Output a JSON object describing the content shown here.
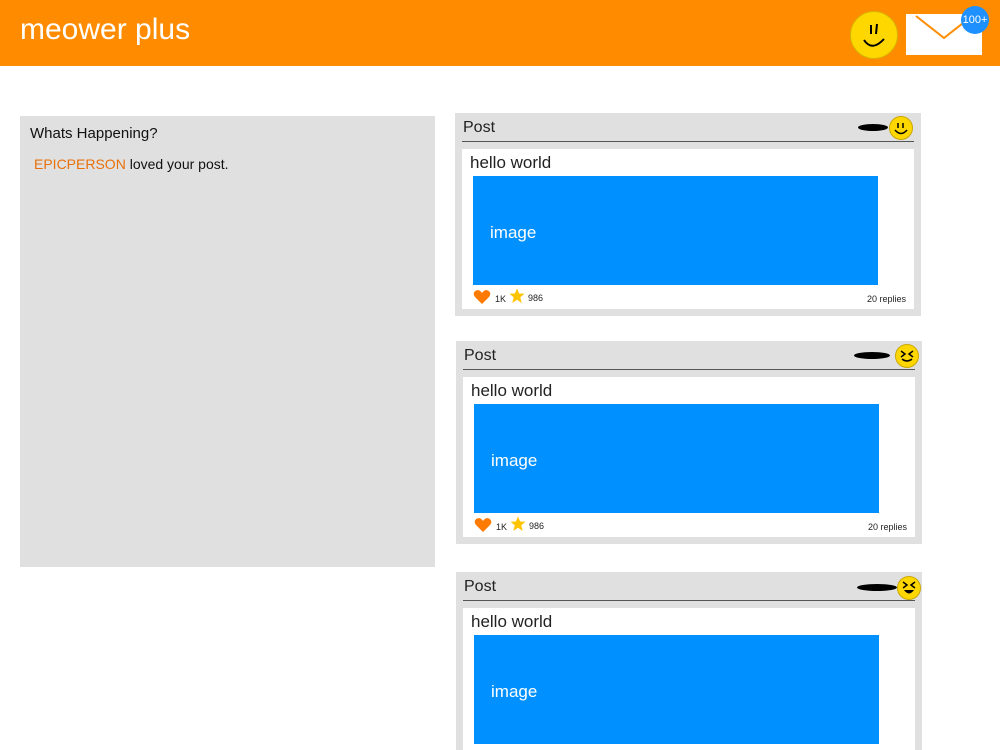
{
  "header": {
    "app_title": "meower plus",
    "mail_badge": "100+"
  },
  "whats_happening": {
    "title": "Whats Happening?",
    "notification": {
      "user": "EPICPERSON",
      "text": " loved your post."
    }
  },
  "posts": [
    {
      "label": "Post",
      "text": "hello world",
      "image_label": "image",
      "likes": "1K",
      "stars": "986",
      "replies": "20 replies",
      "face": "smile"
    },
    {
      "label": "Post",
      "text": "hello world",
      "image_label": "image",
      "likes": "1K",
      "stars": "986",
      "replies": "20 replies",
      "face": "squint"
    },
    {
      "label": "Post",
      "text": "hello world",
      "image_label": "image",
      "face": "laugh"
    }
  ],
  "colors": {
    "header": "#FF8C00",
    "accent_user": "#E8710A",
    "image": "#0090FF",
    "badge": "#1E90FF",
    "heart": "#FF7A00",
    "star": "#FFC400"
  }
}
